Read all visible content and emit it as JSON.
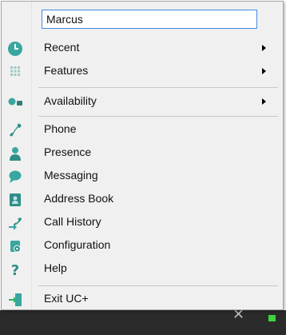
{
  "search": {
    "value": "Marcus"
  },
  "menu": {
    "group1": [
      {
        "label": "Recent",
        "icon": "clock-icon",
        "submenu": true
      },
      {
        "label": "Features",
        "icon": "grid-icon",
        "submenu": true
      }
    ],
    "group2": [
      {
        "label": "Availability",
        "icon": "availability-icon",
        "submenu": true
      }
    ],
    "group3": [
      {
        "label": "Phone",
        "icon": "phone-icon"
      },
      {
        "label": "Presence",
        "icon": "person-icon"
      },
      {
        "label": "Messaging",
        "icon": "chat-bubble-icon"
      },
      {
        "label": "Address Book",
        "icon": "address-book-icon"
      },
      {
        "label": "Call History",
        "icon": "call-history-icon"
      },
      {
        "label": "Configuration",
        "icon": "configuration-icon"
      },
      {
        "label": "Help",
        "icon": "help-icon"
      }
    ],
    "group4": [
      {
        "label": "Exit UC+",
        "icon": "exit-icon"
      }
    ]
  },
  "colors": {
    "accent_teal": "#3aa6a0",
    "accent_green": "#2fb36b",
    "input_border": "#3d8ce0"
  }
}
